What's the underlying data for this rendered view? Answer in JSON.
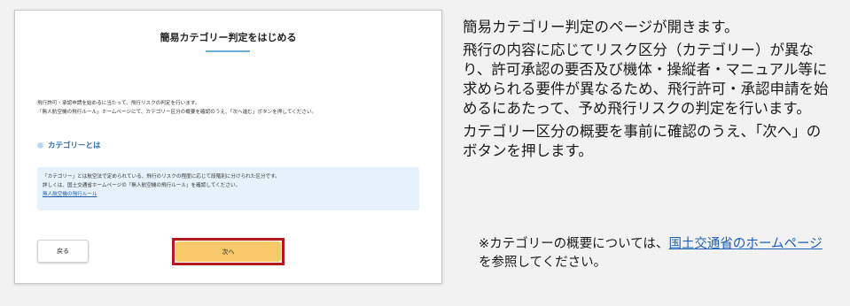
{
  "screenshot": {
    "title": "簡易カテゴリー判定をはじめる",
    "intro_line1": "飛行許可・承認申請を始めるに当たって、飛行リスクの判定を行います。",
    "intro_line2": "「無人航空機の飛行ルール」ホームページにて、カテゴリー区分の概要を確認のうえ、「次へ進む」ボタンを押してください。",
    "category_heading": "カテゴリーとは",
    "info_line1": "「カテゴリー」とは航空法で定められている、飛行のリスクの程度に応じて段階別に分けられた区分です。",
    "info_line2": "詳しくは、国土交通省ホームページの「無人航空機の飛行ルール」を確認してください。",
    "info_link": "無人航空機の飛行ルール",
    "back_button": "戻る",
    "next_button": "次へ"
  },
  "description": {
    "p1": "簡易カテゴリー判定のページが開きます。",
    "p2": "飛行の内容に応じてリスク区分（カテゴリー）が異なり、許可承認の要否及び機体・操縦者・マニュアル等に求められる要件が異なるため、飛行許可・承認申請を始めるにあたって、予め飛行リスクの判定を行います。",
    "p3": "カテゴリー区分の概要を事前に確認のうえ、「次へ」のボタンを押します。"
  },
  "note": {
    "prefix": "※カテゴリーの概要については、",
    "link": "国土交通省のホームページ",
    "suffix": "を参照してください。"
  },
  "colors": {
    "highlight_border": "#b5191f",
    "next_button_bg": "#f7c96b",
    "info_box_bg": "#e6f1fb",
    "link": "#1f5fb5"
  }
}
